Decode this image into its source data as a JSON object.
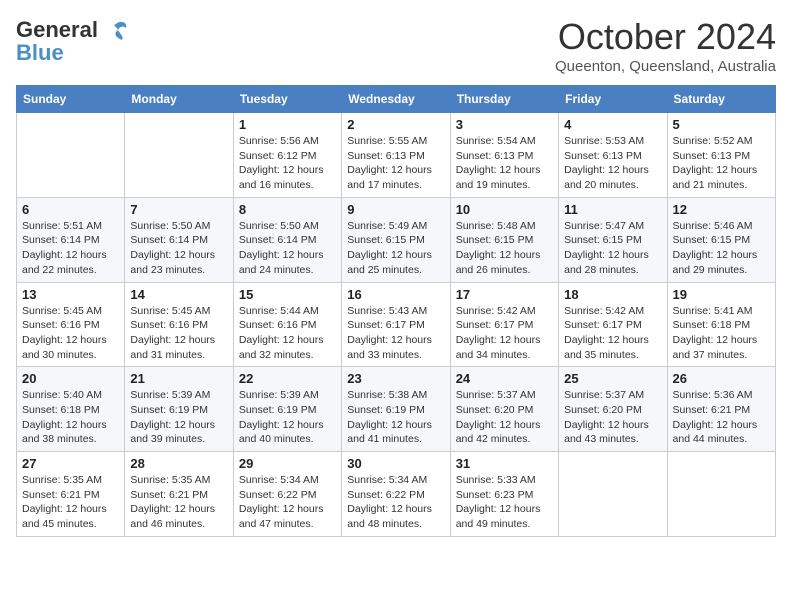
{
  "header": {
    "logo_general": "General",
    "logo_blue": "Blue",
    "month_year": "October 2024",
    "location": "Queenton, Queensland, Australia"
  },
  "days_of_week": [
    "Sunday",
    "Monday",
    "Tuesday",
    "Wednesday",
    "Thursday",
    "Friday",
    "Saturday"
  ],
  "weeks": [
    [
      {
        "day": "",
        "info": ""
      },
      {
        "day": "",
        "info": ""
      },
      {
        "day": "1",
        "info": "Sunrise: 5:56 AM\nSunset: 6:12 PM\nDaylight: 12 hours and 16 minutes."
      },
      {
        "day": "2",
        "info": "Sunrise: 5:55 AM\nSunset: 6:13 PM\nDaylight: 12 hours and 17 minutes."
      },
      {
        "day": "3",
        "info": "Sunrise: 5:54 AM\nSunset: 6:13 PM\nDaylight: 12 hours and 19 minutes."
      },
      {
        "day": "4",
        "info": "Sunrise: 5:53 AM\nSunset: 6:13 PM\nDaylight: 12 hours and 20 minutes."
      },
      {
        "day": "5",
        "info": "Sunrise: 5:52 AM\nSunset: 6:13 PM\nDaylight: 12 hours and 21 minutes."
      }
    ],
    [
      {
        "day": "6",
        "info": "Sunrise: 5:51 AM\nSunset: 6:14 PM\nDaylight: 12 hours and 22 minutes."
      },
      {
        "day": "7",
        "info": "Sunrise: 5:50 AM\nSunset: 6:14 PM\nDaylight: 12 hours and 23 minutes."
      },
      {
        "day": "8",
        "info": "Sunrise: 5:50 AM\nSunset: 6:14 PM\nDaylight: 12 hours and 24 minutes."
      },
      {
        "day": "9",
        "info": "Sunrise: 5:49 AM\nSunset: 6:15 PM\nDaylight: 12 hours and 25 minutes."
      },
      {
        "day": "10",
        "info": "Sunrise: 5:48 AM\nSunset: 6:15 PM\nDaylight: 12 hours and 26 minutes."
      },
      {
        "day": "11",
        "info": "Sunrise: 5:47 AM\nSunset: 6:15 PM\nDaylight: 12 hours and 28 minutes."
      },
      {
        "day": "12",
        "info": "Sunrise: 5:46 AM\nSunset: 6:15 PM\nDaylight: 12 hours and 29 minutes."
      }
    ],
    [
      {
        "day": "13",
        "info": "Sunrise: 5:45 AM\nSunset: 6:16 PM\nDaylight: 12 hours and 30 minutes."
      },
      {
        "day": "14",
        "info": "Sunrise: 5:45 AM\nSunset: 6:16 PM\nDaylight: 12 hours and 31 minutes."
      },
      {
        "day": "15",
        "info": "Sunrise: 5:44 AM\nSunset: 6:16 PM\nDaylight: 12 hours and 32 minutes."
      },
      {
        "day": "16",
        "info": "Sunrise: 5:43 AM\nSunset: 6:17 PM\nDaylight: 12 hours and 33 minutes."
      },
      {
        "day": "17",
        "info": "Sunrise: 5:42 AM\nSunset: 6:17 PM\nDaylight: 12 hours and 34 minutes."
      },
      {
        "day": "18",
        "info": "Sunrise: 5:42 AM\nSunset: 6:17 PM\nDaylight: 12 hours and 35 minutes."
      },
      {
        "day": "19",
        "info": "Sunrise: 5:41 AM\nSunset: 6:18 PM\nDaylight: 12 hours and 37 minutes."
      }
    ],
    [
      {
        "day": "20",
        "info": "Sunrise: 5:40 AM\nSunset: 6:18 PM\nDaylight: 12 hours and 38 minutes."
      },
      {
        "day": "21",
        "info": "Sunrise: 5:39 AM\nSunset: 6:19 PM\nDaylight: 12 hours and 39 minutes."
      },
      {
        "day": "22",
        "info": "Sunrise: 5:39 AM\nSunset: 6:19 PM\nDaylight: 12 hours and 40 minutes."
      },
      {
        "day": "23",
        "info": "Sunrise: 5:38 AM\nSunset: 6:19 PM\nDaylight: 12 hours and 41 minutes."
      },
      {
        "day": "24",
        "info": "Sunrise: 5:37 AM\nSunset: 6:20 PM\nDaylight: 12 hours and 42 minutes."
      },
      {
        "day": "25",
        "info": "Sunrise: 5:37 AM\nSunset: 6:20 PM\nDaylight: 12 hours and 43 minutes."
      },
      {
        "day": "26",
        "info": "Sunrise: 5:36 AM\nSunset: 6:21 PM\nDaylight: 12 hours and 44 minutes."
      }
    ],
    [
      {
        "day": "27",
        "info": "Sunrise: 5:35 AM\nSunset: 6:21 PM\nDaylight: 12 hours and 45 minutes."
      },
      {
        "day": "28",
        "info": "Sunrise: 5:35 AM\nSunset: 6:21 PM\nDaylight: 12 hours and 46 minutes."
      },
      {
        "day": "29",
        "info": "Sunrise: 5:34 AM\nSunset: 6:22 PM\nDaylight: 12 hours and 47 minutes."
      },
      {
        "day": "30",
        "info": "Sunrise: 5:34 AM\nSunset: 6:22 PM\nDaylight: 12 hours and 48 minutes."
      },
      {
        "day": "31",
        "info": "Sunrise: 5:33 AM\nSunset: 6:23 PM\nDaylight: 12 hours and 49 minutes."
      },
      {
        "day": "",
        "info": ""
      },
      {
        "day": "",
        "info": ""
      }
    ]
  ]
}
